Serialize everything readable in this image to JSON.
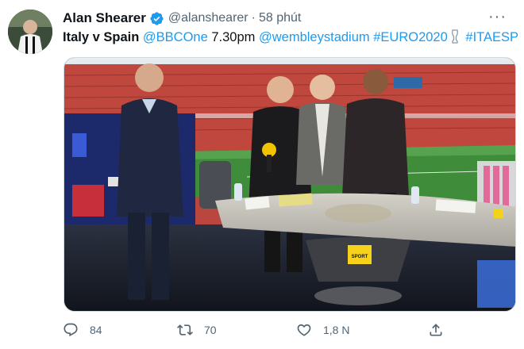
{
  "tweet": {
    "author_name": "Alan Shearer",
    "handle": "@alanshearer",
    "separator": "·",
    "time": "58 phút",
    "more_label": "···",
    "text": {
      "bold_part": "Italy v Spain",
      "mention_1": "@BBCOne",
      "time_part": "7.30pm",
      "mention_2": "@wembleystadium",
      "hashtag_1": "#EURO2020",
      "hashtag_2": "#ITAESP"
    },
    "media": {
      "mic_label": "SPORT",
      "desk_logo_label": "SPORT"
    }
  },
  "actions": {
    "replies": "84",
    "retweets": "70",
    "likes": "1,8 N"
  },
  "colors": {
    "link": "#1d9bf0",
    "secondary_text": "#536471",
    "verified": "#1d9bf0"
  }
}
